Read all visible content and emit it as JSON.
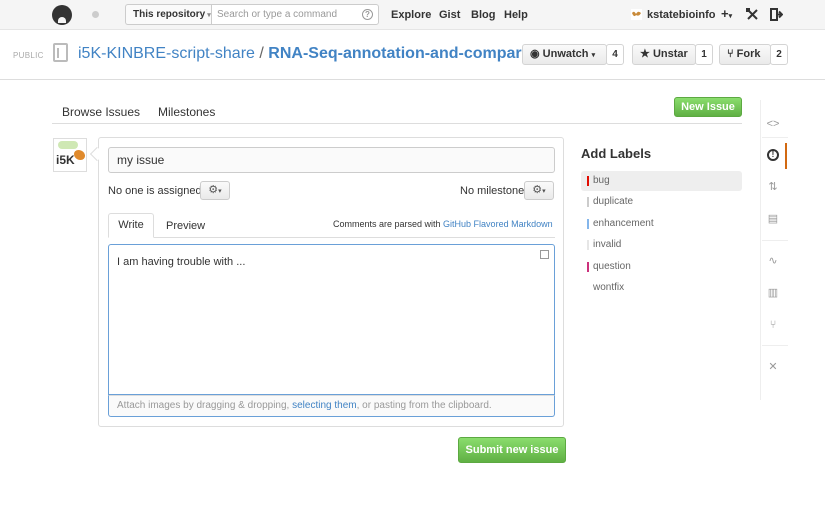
{
  "topbar": {
    "scope": "This repository",
    "search_placeholder": "Search or type a command",
    "search_help": "?",
    "nav": [
      "Explore",
      "Gist",
      "Blog",
      "Help"
    ],
    "username": "kstatebioinfo",
    "plus_icon": "+",
    "caret": "▾"
  },
  "repo": {
    "visibility": "PUBLIC",
    "owner": "i5K-KINBRE-script-share",
    "separator": "/",
    "name": "RNA-Seq-annotation-and-comparison",
    "unwatch_label": "Unwatch",
    "watch_count": "4",
    "unstar_label": "Unstar",
    "star_count": "1",
    "fork_label": "Fork",
    "fork_count": "2"
  },
  "subnav": {
    "browse_issues": "Browse Issues",
    "milestones": "Milestones",
    "new_issue": "New Issue"
  },
  "form": {
    "title_value": "my issue",
    "assignee_text": "No one is assigned",
    "milestone_text": "No milestone",
    "tab_write": "Write",
    "tab_preview": "Preview",
    "markdown_prefix": "Comments are parsed with ",
    "markdown_link": "GitHub Flavored Markdown",
    "body_value": "I am having trouble with ...",
    "drop_prefix": "Attach images by dragging & dropping, ",
    "drop_link": "selecting them",
    "drop_suffix": ", or pasting from the clipboard.",
    "submit": "Submit new issue"
  },
  "avatar_text": "i5K",
  "labels": {
    "title": "Add Labels",
    "items": [
      {
        "name": "bug",
        "color": "#e10c02"
      },
      {
        "name": "duplicate",
        "color": "#cccccc"
      },
      {
        "name": "enhancement",
        "color": "#84b6eb"
      },
      {
        "name": "invalid",
        "color": "#e6e6e6"
      },
      {
        "name": "question",
        "color": "#cc317c"
      },
      {
        "name": "wontfix",
        "color": "#ffffff"
      }
    ]
  },
  "colors": {
    "accent": "#4183c4",
    "green_button": "#60b044",
    "rail_active": "#d26911"
  }
}
